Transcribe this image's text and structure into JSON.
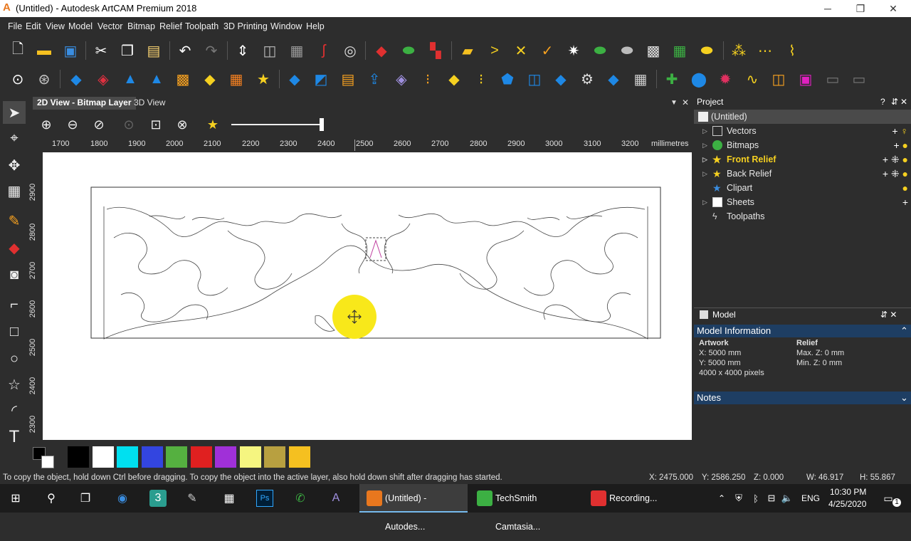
{
  "window": {
    "title": "(Untitled) - Autodesk ArtCAM Premium 2018",
    "minimize": "─",
    "restore": "❐",
    "close": "✕"
  },
  "menu": [
    "File",
    "Edit",
    "View",
    "Model",
    "Vector",
    "Bitmap",
    "Relief",
    "Toolpath",
    "3D Printing",
    "Window",
    "Help"
  ],
  "toolbar_row1": [
    "new-file-icon",
    "open-folder-icon",
    "save-icon",
    "cut-icon",
    "copy-icon",
    "paste-icon",
    "undo-icon",
    "redo-icon",
    "scale-model-icon",
    "align-icon",
    "texture-icon",
    "magnet-icon",
    "sphere-icon",
    "eraser-icon",
    "layers-green-icon",
    "color-grid-icon",
    "folder-open-icon",
    "vector-arrow-icon",
    "cross-tool-icon",
    "mark-tool-icon",
    "star-burst-icon",
    "relief-green-icon",
    "relief-grey-icon",
    "maze-icon",
    "grid-green-icon",
    "relief-yellow-icon",
    "nodes-icon",
    "nodes-yellow-icon",
    "nodes-line-icon"
  ],
  "toolbar_row2": [
    "zoom-fit-icon",
    "globe-icon",
    "diamond-icon",
    "eraser-red-icon",
    "prism-icon",
    "prism-blue-icon",
    "weave-icon",
    "cube-yellow-icon",
    "dot-orange-icon",
    "star-folder-icon",
    "plane-icon",
    "split-icon",
    "stripes-icon",
    "upload-icon",
    "layers-purple-icon",
    "dots-icon",
    "plate-yellow-icon",
    "dot-small-icon",
    "tilt-icon",
    "stack-icon",
    "blue-tile-icon",
    "tool-icon",
    "flat-diamond-icon",
    "boxes-icon",
    "add-green-icon",
    "can-icon",
    "gear-pink-icon",
    "wave-icon",
    "mirror-icon",
    "pink-square-icon",
    "outline-icon",
    "outline2-icon"
  ],
  "tabs": {
    "view2d": "2D View - Bitmap Layer",
    "view3d": "3D View"
  },
  "ruler": {
    "units": "millimetres",
    "h_ticks": [
      "1700",
      "1800",
      "1900",
      "2000",
      "2100",
      "2200",
      "2300",
      "2400",
      "2500",
      "2600",
      "2700",
      "2800",
      "2900",
      "3000",
      "3100",
      "3200"
    ],
    "v_ticks": [
      "2900",
      "2800",
      "2700",
      "2600",
      "2500",
      "2400",
      "2300"
    ]
  },
  "palette": {
    "colors": [
      "#000000",
      "#ffffff",
      "#00e0f0",
      "#3345e0",
      "#55b040",
      "#e02020",
      "#a030d8",
      "#f5f580",
      "#b8a040",
      "#f5c020"
    ]
  },
  "status": {
    "hint": "To copy the object, hold down Ctrl before dragging. To copy the object into the active layer, also hold down shift after dragging has started.",
    "x": "X: 2475.000",
    "y": "Y: 2586.250",
    "z": "Z: 0.000",
    "w": "W: 46.917",
    "h": "H: 55.867"
  },
  "project": {
    "header": "Project",
    "header_buttons": [
      "?",
      "⇵",
      "✕"
    ],
    "items": [
      {
        "label": "(Untitled)"
      },
      {
        "label": "Vectors"
      },
      {
        "label": "Bitmaps"
      },
      {
        "label": "Front Relief"
      },
      {
        "label": "Back Relief"
      },
      {
        "label": "Clipart"
      },
      {
        "label": "Sheets"
      },
      {
        "label": "Toolpaths"
      }
    ],
    "model_header": "Model",
    "model_info_header": "Model Information",
    "artwork_title": "Artwork",
    "artwork_x": "X: 5000 mm",
    "artwork_y": "Y: 5000 mm",
    "artwork_px": "4000 x 4000 pixels",
    "relief_title": "Relief",
    "relief_max": "Max. Z: 0 mm",
    "relief_min": "Min. Z: 0 mm",
    "notes_header": "Notes"
  },
  "taskbar": {
    "apps": [
      {
        "label": "(Untitled) - Autodes..."
      },
      {
        "label": "TechSmith Camtasia..."
      },
      {
        "label": "Recording..."
      }
    ],
    "lang": "ENG",
    "time": "10:30 PM",
    "date": "4/25/2020",
    "notif": "1"
  }
}
